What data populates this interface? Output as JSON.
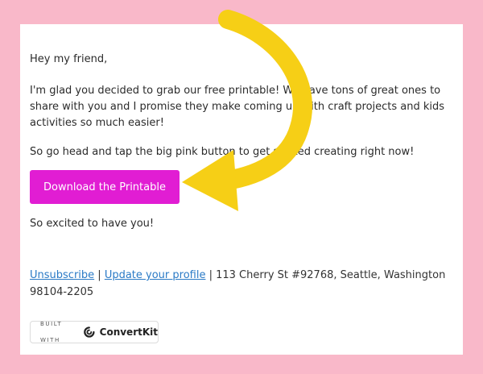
{
  "email": {
    "greeting": "Hey my friend,",
    "paragraph1": "I'm glad you decided to grab our free printable! We have tons of great ones to share with you and I promise they make coming up with craft projects and kids activities so much easier!",
    "paragraph2": "So go head and tap the big pink button to get started creating right now!",
    "cta_label": "Download the Printable",
    "signoff": "So excited to have you!"
  },
  "footer": {
    "unsubscribe": "Unsubscribe",
    "separator1": " | ",
    "update_profile": "Update your profile",
    "address": " | 113 Cherry St #92768, Seattle, Washington 98104-2205"
  },
  "badge": {
    "built_with": "BUILT WITH",
    "brand": "ConvertKit"
  },
  "colors": {
    "background": "#f9b8c9",
    "cta": "#e11dd3",
    "arrow": "#f6cf16",
    "link": "#2a7ac6"
  },
  "icons": {
    "brand_logo": "convertkit-logo-icon",
    "overlay_arrow": "curved-arrow-icon"
  }
}
